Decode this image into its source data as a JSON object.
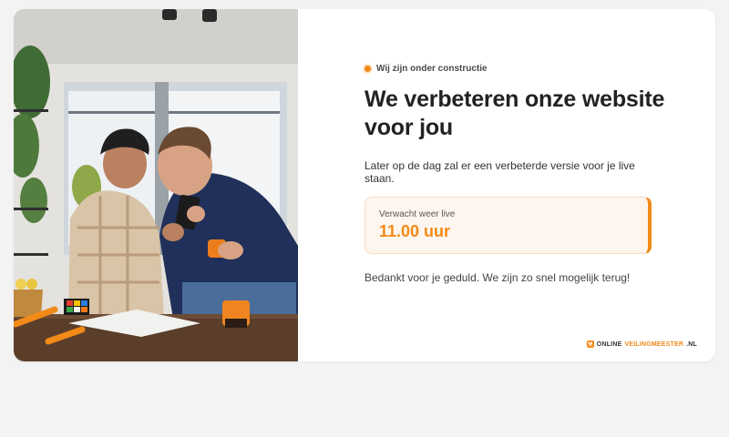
{
  "status": {
    "label": "Wij zijn onder constructie"
  },
  "headline": "We verbeteren onze website voor jou",
  "subtitle": "Later op de dag zal er een verbeterde versie voor je live staan.",
  "expected": {
    "label": "Verwacht weer live",
    "time": "11.00 uur"
  },
  "thanks": "Bedankt voor je geduld. We zijn zo snel mogelijk terug!",
  "brand": {
    "part1": "ONLINE",
    "part2": "VEILINGMEESTER",
    "part3": ".NL",
    "icon": "gavel-icon"
  },
  "colors": {
    "accent": "#f28a18",
    "background": "#f3f3f4",
    "card": "#ffffff"
  }
}
